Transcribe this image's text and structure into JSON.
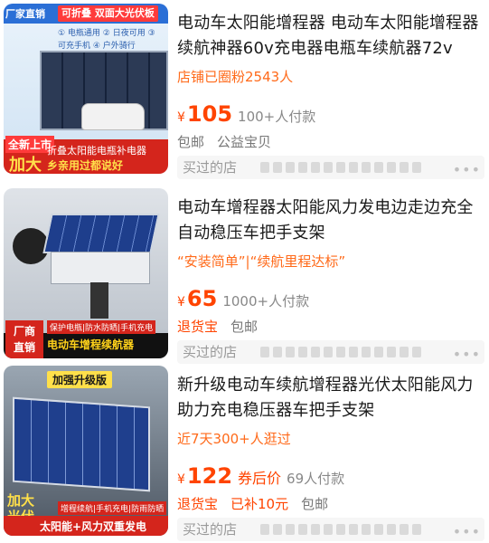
{
  "products": [
    {
      "title": "电动车太阳能增程器 电动车太阳能增程器续航神器60v充电器电瓶车续航器72v",
      "subline": "店铺已圈粉2543人",
      "price_symbol": "¥",
      "price": "105",
      "coupon": "",
      "paid": "100+人付款",
      "tags": [
        "包邮",
        "公益宝贝"
      ],
      "bought": "买过的店",
      "thumb": {
        "badge1": "厂家直销",
        "badge2": "可折叠 双面大光伏板",
        "chips": "① 电瓶通用 ② 日夜可用 ③ 可充手机 ④ 户外骑行",
        "new": "全新上市",
        "big": "加大",
        "red1": "折叠太阳能电瓶补电器",
        "red2": "乡亲用过都说好"
      }
    },
    {
      "title": "电动车增程器太阳能风力发电边走边充全自动稳压车把手支架",
      "subline": "“安装简单”|“续航里程达标”",
      "price_symbol": "¥",
      "price": "65",
      "coupon": "",
      "paid": "1000+人付款",
      "tags": [
        "退货宝",
        "包邮"
      ],
      "bought": "买过的店",
      "thumb": {
        "factory1": "厂商",
        "factory2": "直销",
        "chips": "保护电瓶|防水防晒|手机充电",
        "caption": "电动车增程续航器"
      }
    },
    {
      "title": "新升级电动车续航增程器光伏太阳能风力助力充电稳压器车把手支架",
      "subline": "近7天300+人逛过",
      "price_symbol": "¥",
      "price": "122",
      "coupon": "券后价",
      "paid": "69人付款",
      "tags": [
        "退货宝",
        "已补10元",
        "包邮"
      ],
      "bought": "买过的店",
      "thumb": {
        "pill": "加强升级版",
        "big1": "加大",
        "big2": "光伏",
        "chips": "增程续航|手机充电|防雨防晒",
        "caption": "太阳能+风力双重发电"
      }
    }
  ],
  "colors": {
    "accent": "#ff4400",
    "subline": "#ff6a1a",
    "muted": "#888888"
  },
  "icons": {
    "more": "more-dots-icon"
  },
  "more_glyph": "•••"
}
